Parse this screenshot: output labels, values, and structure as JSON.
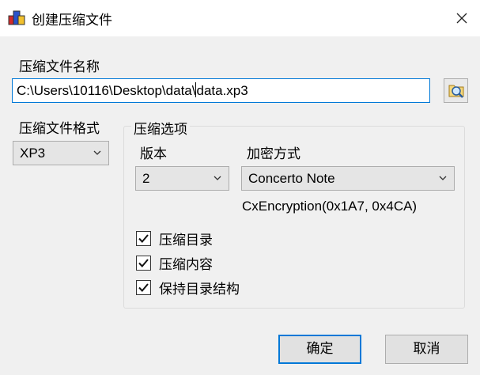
{
  "window": {
    "title": "创建压缩文件"
  },
  "filename": {
    "label": "压缩文件名称",
    "path_before_caret": "C:\\Users\\10116\\Desktop\\data\\",
    "path_after_caret": "data.xp3"
  },
  "format": {
    "label": "压缩文件格式",
    "value": "XP3"
  },
  "options": {
    "legend": "压缩选项",
    "version_label": "版本",
    "version_value": "2",
    "encryption_label": "加密方式",
    "encryption_value": "Concerto Note",
    "encryption_detail": "CxEncryption(0x1A7, 0x4CA)",
    "checkboxes": [
      {
        "label": "压缩目录",
        "checked": true
      },
      {
        "label": "压缩内容",
        "checked": true
      },
      {
        "label": "保持目录结构",
        "checked": true
      }
    ]
  },
  "buttons": {
    "ok": "确定",
    "cancel": "取消"
  }
}
